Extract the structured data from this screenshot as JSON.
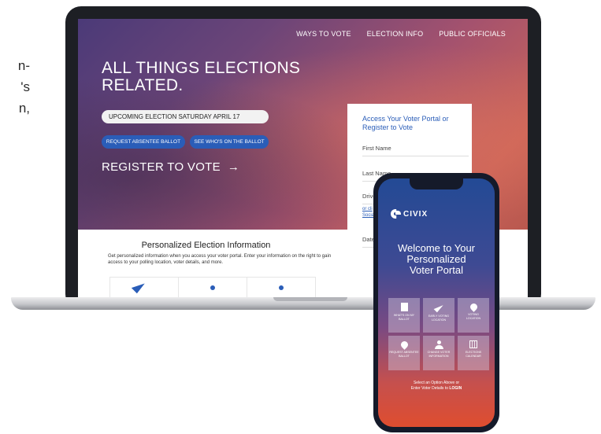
{
  "page_text": {
    "lines": [
      "n-",
      "'s",
      "n,"
    ]
  },
  "laptop_site": {
    "nav": [
      "WAYS TO VOTE",
      "ELECTION INFO",
      "PUBLIC OFFICIALS"
    ],
    "hero": {
      "title_line1": "ALL THINGS ELECTIONS",
      "title_line2": "RELATED.",
      "upcoming": "UPCOMING ELECTION SATURDAY APRIL 17",
      "btn_absentee": "REQUEST ABSENTEE BALLOT",
      "btn_ballot": "SEE WHO'S ON THE BALLOT",
      "register": "REGISTER TO VOTE",
      "register_arrow": "→"
    },
    "form": {
      "title_line1": "Access Your Voter Portal or",
      "title_line2": "Register to Vote",
      "first_name": "First Name",
      "last_name": "Last Name",
      "drivers": "Drive",
      "or_link_line1": "or cli",
      "or_link_line2": "Social",
      "date": "Date"
    },
    "info": {
      "title": "Personalized Election Information",
      "desc": "Get personalized information when you access your voter portal.  Enter your information on the right to gain access to your polling location, voter details, and more."
    }
  },
  "phone_app": {
    "brand": "CIVIX",
    "welcome_line1": "Welcome to Your",
    "welcome_line2": "Personalized",
    "welcome_line3": "Voter Portal",
    "tiles": [
      {
        "line1": "WHAT'S ON MY",
        "line2": "BALLOT",
        "icon": "document-icon"
      },
      {
        "line1": "EARLY VOTING",
        "line2": "LOCATION",
        "icon": "navigation-arrow-icon"
      },
      {
        "line1": "VOTING",
        "line2": "LOCATION",
        "icon": "location-pin-icon"
      },
      {
        "line1": "REQUEST ABSENTEE",
        "line2": "BALLOT",
        "icon": "location-pin-icon"
      },
      {
        "line1": "CHANGE VOTER",
        "line2": "INFORMATION",
        "icon": "user-icon"
      },
      {
        "line1": "ELECTIONS",
        "line2": "CALENDAR",
        "icon": "calendar-icon"
      }
    ],
    "footer_line1": "Select an Option Above or",
    "footer_line2_prefix": "Enter Voter Details to ",
    "footer_login": "LOGIN"
  },
  "colors": {
    "accent_blue": "#2a5db8",
    "phone_gradient_top": "#234a95",
    "phone_gradient_bottom": "#df4d2f",
    "hero_purple": "#4b3a78",
    "hero_red": "#c8625a"
  }
}
